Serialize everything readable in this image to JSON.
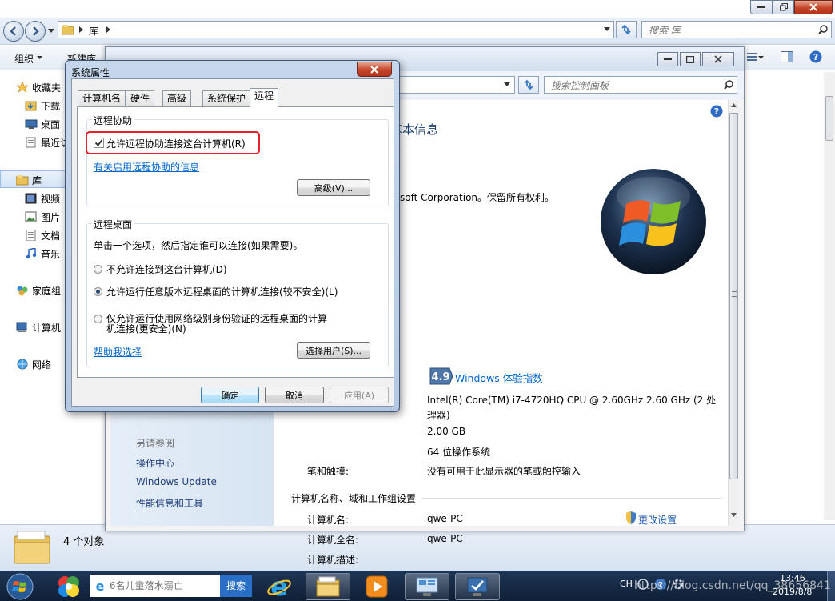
{
  "explorer": {
    "address_crumb": "库",
    "search_placeholder": "搜索 库",
    "toolbar": {
      "organize": "组织",
      "new_library": "新建库"
    },
    "nav": {
      "favorites": "收藏夹",
      "favorites_items": [
        "下载",
        "桌面",
        "最近访"
      ],
      "libraries": "库",
      "library_items": [
        "视频",
        "图片",
        "文档",
        "音乐"
      ],
      "homegroup": "家庭组",
      "computer": "计算机",
      "network": "网络"
    },
    "status_count": "4 个对象"
  },
  "control_panel": {
    "search_placeholder": "搜索控制面板",
    "heading_fragment": "基本信息",
    "copyright_fragment": "rosoft Corporation。保留所有权利。",
    "rating_score": "4.9",
    "rating_label": "Windows 体验指数",
    "processor": "Intel(R) Core(TM) i7-4720HQ CPU @ 2.60GHz   2.60 GHz  (2 处",
    "processor_cont": "理器)",
    "memory": "2.00 GB",
    "system_type": "64 位操作系统",
    "pen_label": "笔和触摸:",
    "pen_value": "没有可用于此显示器的笔或触控输入",
    "section_computer_name": "计算机名称、域和工作组设置",
    "rows": [
      {
        "label": "计算机名:",
        "value": "qwe-PC"
      },
      {
        "label": "计算机全名:",
        "value": "qwe-PC"
      },
      {
        "label": "计算机描述:",
        "value": ""
      }
    ],
    "change_settings": "更改设置",
    "see_also": {
      "title": "另请参阅",
      "items": [
        "操作中心",
        "Windows Update",
        "性能信息和工具"
      ]
    }
  },
  "dialog": {
    "title": "系统属性",
    "tabs": [
      "计算机名",
      "硬件",
      "高级",
      "系统保护",
      "远程"
    ],
    "remote_assistance": {
      "group": "远程协助",
      "checkbox_label": "允许远程协助连接这台计算机(R)",
      "checked": true,
      "info_link": "有关启用远程协助的信息",
      "advanced_button": "高级(V)..."
    },
    "remote_desktop": {
      "group": "远程桌面",
      "instruction": "单击一个选项，然后指定谁可以连接(如果需要)。",
      "options": [
        "不允许连接到这台计算机(D)",
        "允许运行任意版本远程桌面的计算机连接(较不安全)(L)",
        "仅允许运行使用网络级别身份验证的远程桌面的计算",
        "机连接(更安全)(N)"
      ],
      "selected_index": 1,
      "help_link": "帮助我选择",
      "select_users_button": "选择用户(S)..."
    },
    "buttons": {
      "ok": "确定",
      "cancel": "取消",
      "apply": "应用(A)"
    }
  },
  "taskbar": {
    "search_placeholder": "6名儿童落水溺亡",
    "search_button": "搜索",
    "lang": "CH",
    "time": "13:46",
    "date": "2019/8/8"
  },
  "watermark": "https://blog.csdn.net/qq_38656841",
  "colors": {
    "highlight_box": "#e8202a",
    "link": "#0066cc",
    "taskbar": "#1a3050"
  }
}
